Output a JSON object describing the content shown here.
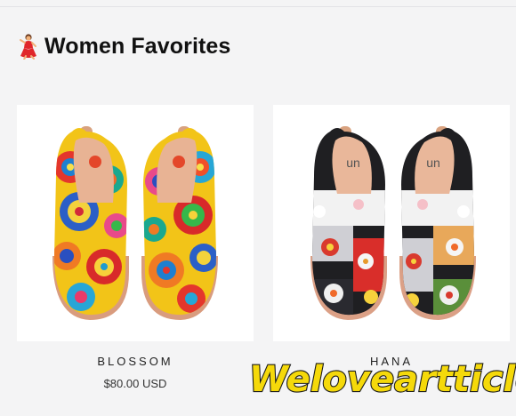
{
  "section": {
    "title": "Women Favorites",
    "emoji_icon": "woman-dancing-icon"
  },
  "products": [
    {
      "name": "BLOSSOM",
      "price": "$80.00 USD",
      "image_icon": "colorful-mandala-slip-on-shoes"
    },
    {
      "name": "HANA",
      "price": "",
      "image_icon": "floral-kimono-slip-on-shoes"
    }
  ],
  "watermark": {
    "text": "Weloveartticle",
    "color": "#f5d90a"
  },
  "colors": {
    "background": "#f4f4f5",
    "card": "#ffffff",
    "text": "#111111"
  }
}
